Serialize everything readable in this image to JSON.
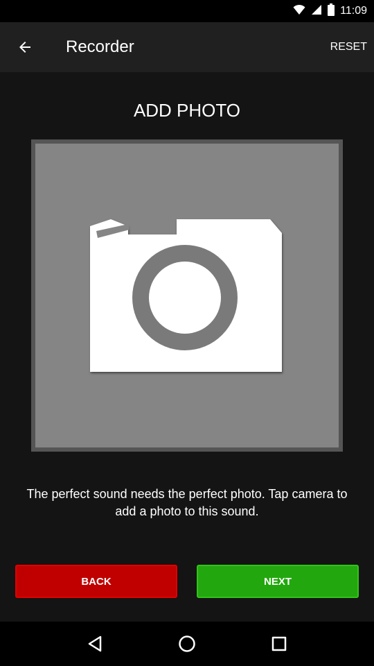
{
  "status": {
    "time": "11:09"
  },
  "app_bar": {
    "title": "Recorder",
    "reset_label": "RESET"
  },
  "main": {
    "heading": "ADD PHOTO",
    "hint": "The perfect sound needs the perfect photo. Tap camera to add a photo to this sound.",
    "back_label": "BACK",
    "next_label": "NEXT"
  },
  "colors": {
    "app_bar_bg": "#202020",
    "content_bg": "#141414",
    "photo_bg": "#858585",
    "back_button": "#c00000",
    "next_button": "#22a80e"
  },
  "icons": {
    "status": [
      "wifi-icon",
      "signal-icon",
      "battery-icon"
    ],
    "nav": [
      "back-triangle-icon",
      "home-circle-icon",
      "recents-square-icon"
    ]
  }
}
